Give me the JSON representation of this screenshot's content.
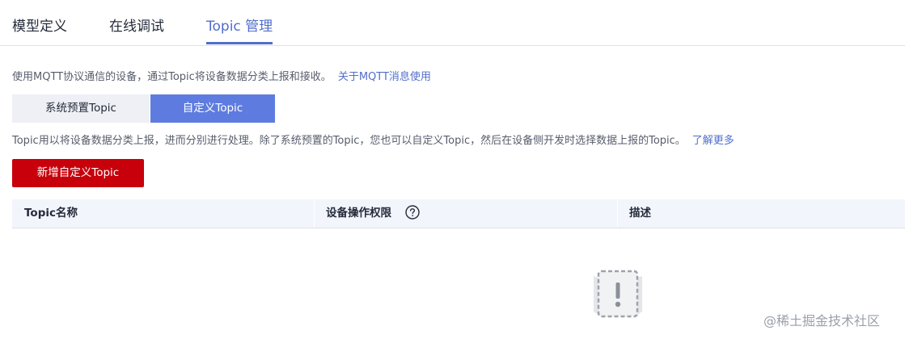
{
  "tabs": [
    {
      "label": "模型定义"
    },
    {
      "label": "在线调试"
    },
    {
      "label": "Topic 管理"
    }
  ],
  "intro": {
    "text": "使用MQTT协议通信的设备，通过Topic将设备数据分类上报和接收。",
    "link": "关于MQTT消息使用"
  },
  "segments": {
    "preset": "系统预置Topic",
    "custom": "自定义Topic"
  },
  "description": {
    "text": "Topic用以将设备数据分类上报，进而分别进行处理。除了系统预置的Topic，您也可以自定义Topic，然后在设备侧开发时选择数据上报的Topic。",
    "link": "了解更多"
  },
  "actions": {
    "add_label": "新增自定义Topic"
  },
  "table": {
    "columns": [
      "Topic名称",
      "设备操作权限",
      "描述"
    ]
  },
  "watermark": "@稀土掘金技术社区",
  "colors": {
    "accent": "#526ecc",
    "segment_active": "#5e7ce0",
    "primary_button": "#c7000b",
    "header_bg": "#f2f5fc"
  }
}
